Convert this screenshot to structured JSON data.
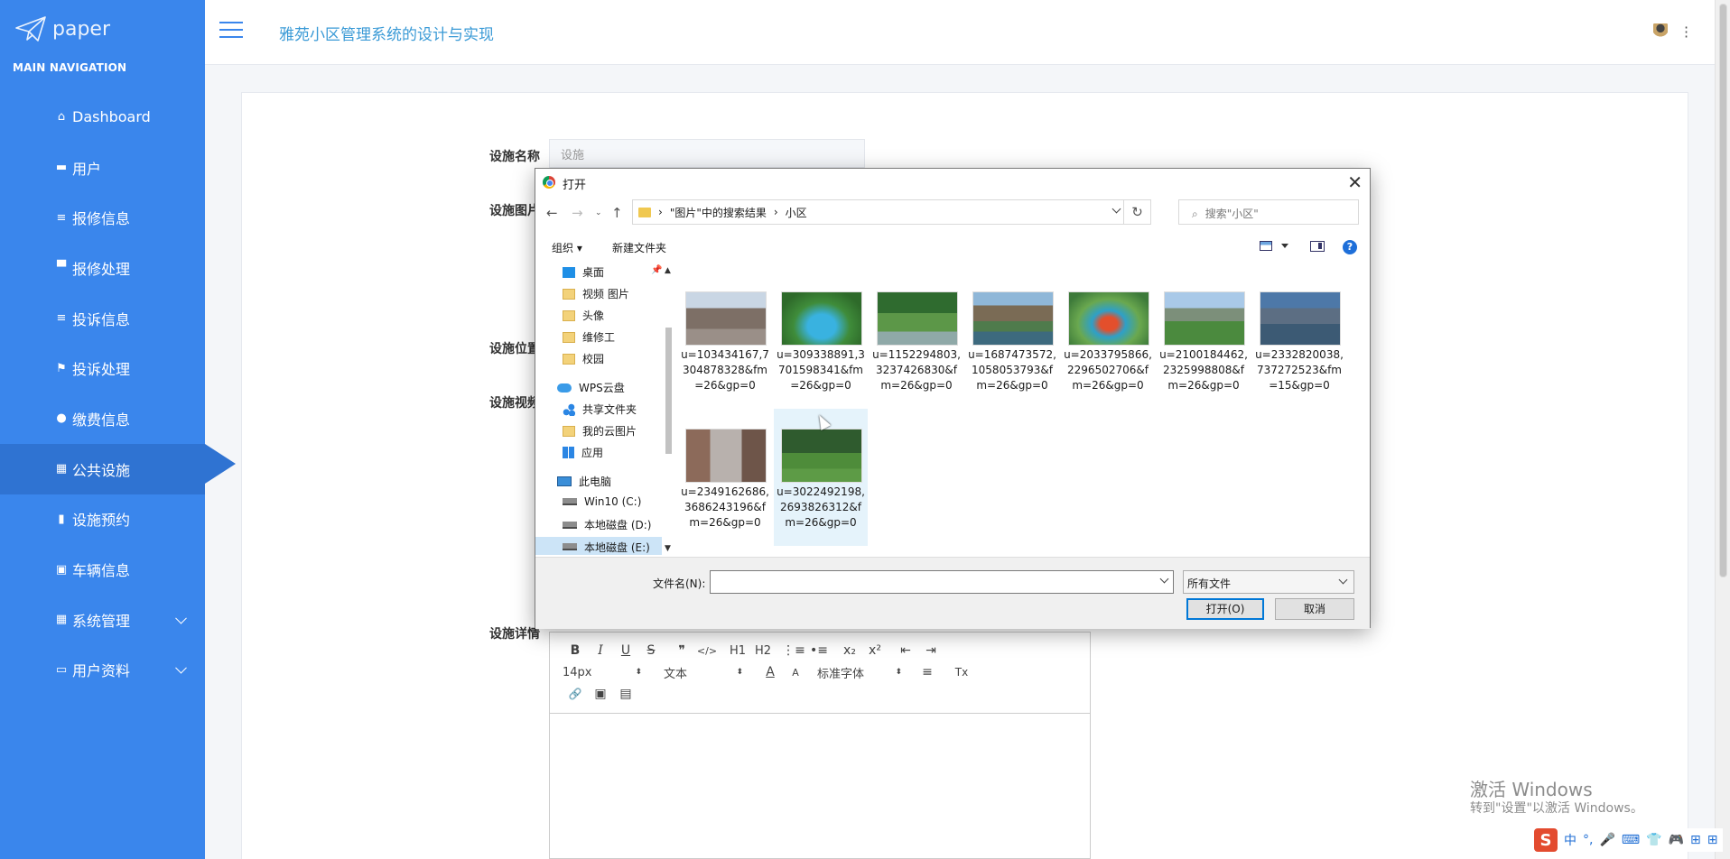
{
  "sidebar": {
    "logo_text": "paper",
    "nav_heading": "MAIN NAVIGATION",
    "items": [
      {
        "label": "Dashboard",
        "icon": "home-icon"
      },
      {
        "label": "用户",
        "icon": "id-card-icon"
      },
      {
        "label": "报修信息",
        "icon": "list-icon"
      },
      {
        "label": "报修处理",
        "icon": "monitor-icon"
      },
      {
        "label": "投诉信息",
        "icon": "list-icon"
      },
      {
        "label": "投诉处理",
        "icon": "flag-icon"
      },
      {
        "label": "缴费信息",
        "icon": "user-icon"
      },
      {
        "label": "公共设施",
        "icon": "grid-icon"
      },
      {
        "label": "设施预约",
        "icon": "book-icon"
      },
      {
        "label": "车辆信息",
        "icon": "clipboard-icon"
      },
      {
        "label": "系统管理",
        "icon": "grid-icon"
      },
      {
        "label": "用户资料",
        "icon": "calendar-icon"
      }
    ]
  },
  "header": {
    "title": "雅苑小区管理系统的设计与实现"
  },
  "form": {
    "name_label": "设施名称",
    "name_value": "设施",
    "image_label": "设施图片",
    "location_label": "设施位置",
    "video_label": "设施视频",
    "detail_label": "设施详情"
  },
  "editor": {
    "font_size": "14px",
    "block_type": "文本",
    "font_family": "标准字体",
    "buttons": {
      "bold": "B",
      "italic": "I",
      "underline": "U",
      "strike": "S",
      "quote": "❞",
      "code": "</>",
      "h1": "H1",
      "h2": "H2",
      "ol": "⋮≡",
      "ul": "•≡",
      "sub": "x₂",
      "sup": "x²",
      "outdent": "⇤",
      "indent": "⇥",
      "color": "A",
      "bg": "A",
      "align": "≡",
      "clear": "Tx",
      "link": "🔗",
      "image": "▣",
      "video": "▤"
    }
  },
  "dialog": {
    "title": "打开",
    "path_part1": "\"图片\"中的搜索结果",
    "path_part2": "小区",
    "search_placeholder": "搜索\"小区\"",
    "organize": "组织 ▾",
    "new_folder": "新建文件夹",
    "tree": [
      "桌面",
      "视频 图片",
      "头像",
      "维修工",
      "校园",
      "WPS云盘",
      "共享文件夹",
      "我的云图片",
      "应用",
      "此电脑",
      "Win10 (C:)",
      "本地磁盘 (D:)",
      "本地磁盘 (E:)"
    ],
    "files": [
      "u=103434167,7304878328&fm=26&gp=0",
      "u=309338891,3701598341&fm=26&gp=0",
      "u=1152294803,3237426830&fm=26&gp=0",
      "u=1687473572,1058053793&fm=26&gp=0",
      "u=2033795866,2296502706&fm=26&gp=0",
      "u=2100184462,2325998808&fm=26&gp=0",
      "u=2332820038,737272523&fm=15&gp=0",
      "u=2349162686,3686243196&fm=26&gp=0",
      "u=3022492198,2693826312&fm=26&gp=0"
    ],
    "filename_label": "文件名(N):",
    "filename_value": "",
    "filetype": "所有文件",
    "open_button": "打开(O)",
    "cancel_button": "取消"
  },
  "watermark": {
    "line1": "激活 Windows",
    "line2": "转到\"设置\"以激活 Windows。"
  },
  "ime": {
    "logo": "S",
    "items": [
      "中",
      "°,",
      "🎤",
      "⌨",
      "👕",
      "🎮",
      "⊞",
      "⊞"
    ]
  },
  "colors": {
    "sidebar_bg": "#3a86ec",
    "sidebar_active": "#2f73d2",
    "title_color": "#3a9ad6"
  }
}
